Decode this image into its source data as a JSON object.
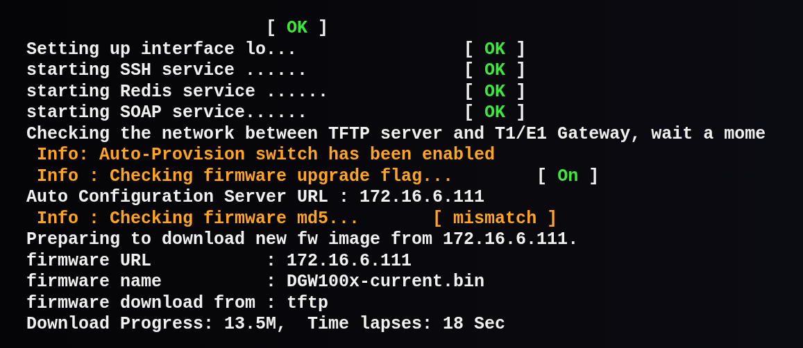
{
  "console": {
    "lines": [
      {
        "kind": "plain",
        "status": {
          "open": "[",
          "label": "OK",
          "close": "]",
          "kind": "ok"
        }
      },
      {
        "kind": "plain",
        "text": "Setting up interface lo...",
        "status": {
          "open": "[",
          "label": "OK",
          "close": "]",
          "kind": "ok"
        }
      },
      {
        "kind": "plain",
        "text": "starting SSH service ......",
        "status": {
          "open": "[",
          "label": "OK",
          "close": "]",
          "kind": "ok"
        }
      },
      {
        "kind": "plain",
        "text": "starting Redis service ......",
        "status": {
          "open": "[",
          "label": "OK",
          "close": "]",
          "kind": "ok"
        }
      },
      {
        "kind": "plain",
        "text": "starting SOAP service......",
        "status": {
          "open": "[",
          "label": "OK",
          "close": "]",
          "kind": "ok"
        }
      },
      {
        "kind": "plain",
        "text": "Checking the network between TFTP server and T1/E1 Gateway, wait a mome"
      },
      {
        "kind": "info",
        "text": "Info: Auto-Provision switch has been enabled"
      },
      {
        "kind": "info",
        "text": "Info : Checking firmware upgrade flag...",
        "status": {
          "open": "[",
          "label": "On",
          "close": "]",
          "kind": "ok"
        }
      },
      {
        "kind": "plain",
        "text": "Auto Configuration Server URL : 172.16.6.111"
      },
      {
        "kind": "info",
        "text": "Info : Checking firmware md5...",
        "status": {
          "open": "[",
          "label": "mismatch",
          "close": "]",
          "kind": "warn"
        }
      },
      {
        "kind": "plain",
        "text": "Preparing to download new fw image from 172.16.6.111."
      },
      {
        "kind": "plain",
        "text": "firmware URL           : 172.16.6.111"
      },
      {
        "kind": "plain",
        "text": "firmware name          : DGW100x-current.bin"
      },
      {
        "kind": "plain",
        "text": "firmware download from : tftp"
      },
      {
        "kind": "plain",
        "text": "Download Progress: 13.5M,  Time lapses: 18 Sec"
      }
    ]
  }
}
